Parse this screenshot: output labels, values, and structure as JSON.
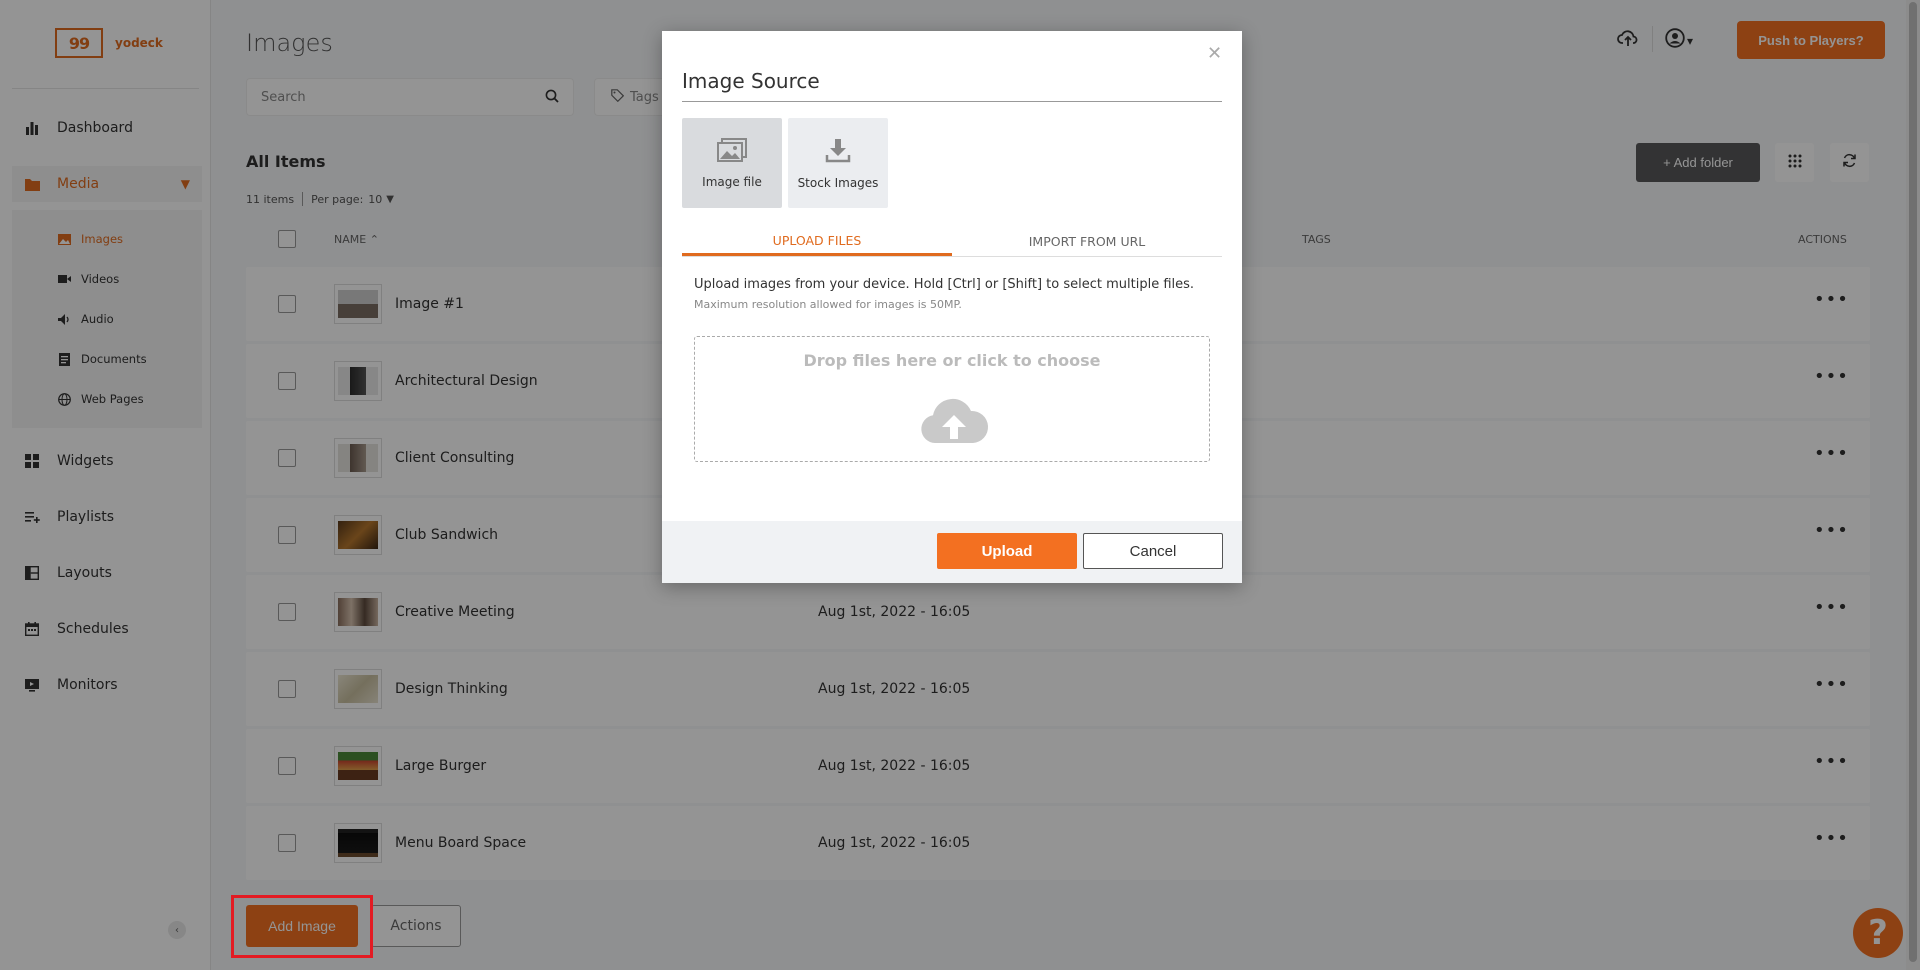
{
  "app": {
    "logo_mark": "99",
    "logo_text": "yodeck"
  },
  "sidebar": {
    "items": [
      {
        "label": "Dashboard",
        "icon": "bar-chart-icon"
      },
      {
        "label": "Media",
        "icon": "folder-icon"
      },
      {
        "label": "Widgets",
        "icon": "widgets-icon"
      },
      {
        "label": "Playlists",
        "icon": "playlist-icon"
      },
      {
        "label": "Layouts",
        "icon": "layouts-icon"
      },
      {
        "label": "Schedules",
        "icon": "calendar-icon"
      },
      {
        "label": "Monitors",
        "icon": "monitor-icon"
      }
    ],
    "media_submenu": [
      {
        "label": "Images",
        "icon": "image-icon"
      },
      {
        "label": "Videos",
        "icon": "video-icon"
      },
      {
        "label": "Audio",
        "icon": "audio-icon"
      },
      {
        "label": "Documents",
        "icon": "document-icon"
      },
      {
        "label": "Web Pages",
        "icon": "globe-icon"
      }
    ]
  },
  "header": {
    "title": "Images",
    "search_placeholder": "Search",
    "tags_placeholder": "Tags",
    "push_label": "Push to Players?"
  },
  "list": {
    "heading": "All Items",
    "count": "11 items",
    "per_page_label": "Per page:",
    "per_page_value": "10",
    "add_folder_label": "+ Add folder",
    "columns": {
      "name": "NAME",
      "tags": "TAGS",
      "actions": "ACTIONS"
    },
    "rows": [
      {
        "name": "Image #1",
        "date": ""
      },
      {
        "name": "Architectural Design",
        "date": ""
      },
      {
        "name": "Client Consulting",
        "date": ""
      },
      {
        "name": "Club Sandwich",
        "date": ""
      },
      {
        "name": "Creative Meeting",
        "date": "Aug 1st, 2022 - 16:05"
      },
      {
        "name": "Design Thinking",
        "date": "Aug 1st, 2022 - 16:05"
      },
      {
        "name": "Large Burger",
        "date": "Aug 1st, 2022 - 16:05"
      },
      {
        "name": "Menu Board Space",
        "date": "Aug 1st, 2022 - 16:05"
      }
    ]
  },
  "footer": {
    "add_image_label": "Add Image",
    "actions_label": "Actions",
    "help_label": "?"
  },
  "modal": {
    "title": "Image Source",
    "sources": [
      {
        "label": "Image file",
        "icon": "image-file-icon",
        "selected": true
      },
      {
        "label": "Stock Images",
        "icon": "download-icon",
        "selected": false
      }
    ],
    "tabs": [
      {
        "label": "UPLOAD FILES",
        "active": true
      },
      {
        "label": "IMPORT FROM URL",
        "active": false
      }
    ],
    "description": "Upload images from your device. Hold [Ctrl] or [Shift] to select multiple files.",
    "note": "Maximum resolution allowed for images is 50MP.",
    "dropzone_text": "Drop files here or click to choose",
    "upload_label": "Upload",
    "cancel_label": "Cancel"
  },
  "colors": {
    "accent": "#f37021",
    "accent_text": "#e06b1f",
    "highlight": "#e31b23",
    "dark_button": "#58595b"
  }
}
